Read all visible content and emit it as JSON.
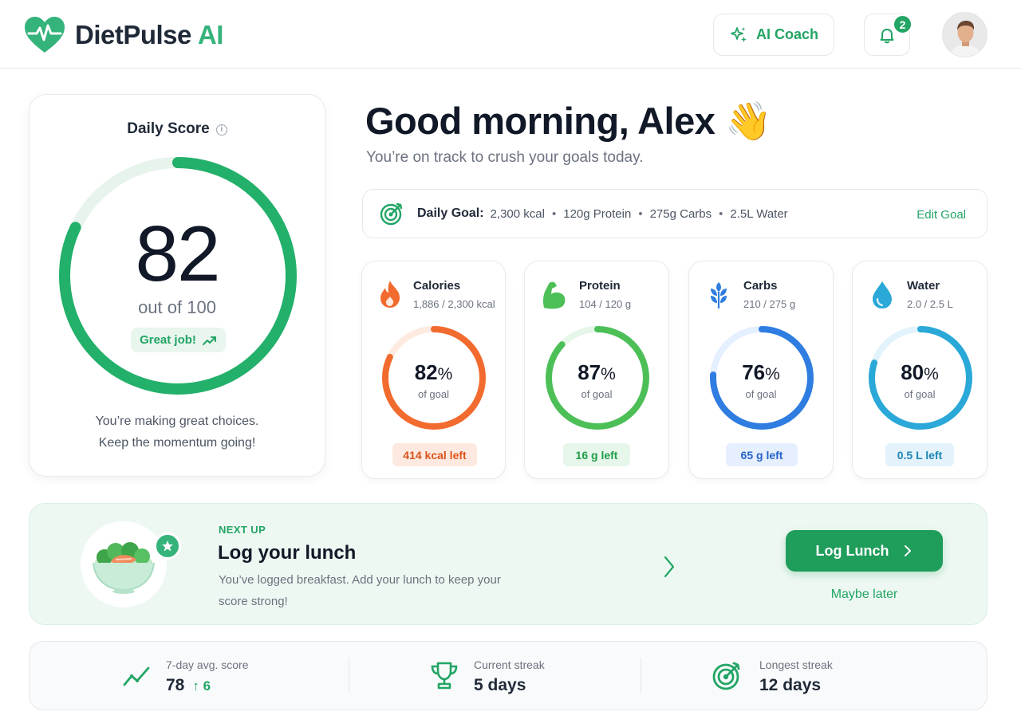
{
  "brand": {
    "name": "DietPulse",
    "suffix": "AI"
  },
  "header": {
    "coach_label": "AI Coach",
    "notifications_count": "2"
  },
  "score": {
    "title": "Daily Score",
    "value": "82",
    "out_of": "out of 100",
    "badge": "Great job!",
    "message_line1": "You’re making great choices.",
    "message_line2": "Keep the momentum going!",
    "progress_fraction": 0.82,
    "color": "#22b06a"
  },
  "greeting": {
    "title": "Good morning, Alex",
    "emoji": "👋",
    "subtitle": "You’re on track to crush your goals today."
  },
  "goal": {
    "label": "Daily Goal:",
    "items": [
      "2,300 kcal",
      "120g Protein",
      "275g Carbs",
      "2.5L Water"
    ],
    "separator": "•",
    "edit_label": "Edit Goal"
  },
  "macros": [
    {
      "name": "Calories",
      "value": "1,886 / 2,300 kcal",
      "percent": "82",
      "pct_sign": "%",
      "of_goal": "of goal",
      "left": "414 kcal left",
      "fraction": 0.82,
      "color": "#f26b2e",
      "track": "#fdebe1",
      "pill_bg": "#fde9e0",
      "pill_fg": "#d9541b",
      "icon": "fire-icon"
    },
    {
      "name": "Protein",
      "value": "104 / 120 g",
      "percent": "87",
      "pct_sign": "%",
      "of_goal": "of goal",
      "left": "16 g left",
      "fraction": 0.87,
      "color": "#4cbf56",
      "track": "#e6f6e8",
      "pill_bg": "#e7f6ea",
      "pill_fg": "#1f9d48",
      "icon": "flexed-arm-icon"
    },
    {
      "name": "Carbs",
      "value": "210 / 275 g",
      "percent": "76",
      "pct_sign": "%",
      "of_goal": "of goal",
      "left": "65 g left",
      "fraction": 0.76,
      "color": "#2f7de1",
      "track": "#e4efff",
      "pill_bg": "#e6effd",
      "pill_fg": "#2563c9",
      "icon": "grain-icon"
    },
    {
      "name": "Water",
      "value": "2.0 / 2.5 L",
      "percent": "80",
      "pct_sign": "%",
      "of_goal": "of goal",
      "left": "0.5 L left",
      "fraction": 0.8,
      "color": "#2aa8d8",
      "track": "#e3f3fb",
      "pill_bg": "#e4f3fb",
      "pill_fg": "#1e86b5",
      "icon": "water-drop-icon"
    }
  ],
  "next_up": {
    "kicker": "NEXT UP",
    "title": "Log your lunch",
    "description": "You’ve logged breakfast. Add your lunch to keep your score strong!",
    "button": "Log Lunch",
    "secondary": "Maybe later"
  },
  "stats": [
    {
      "label": "7-day avg. score",
      "value": "78",
      "delta": "↑ 6",
      "icon": "trend-line-icon"
    },
    {
      "label": "Current streak",
      "value": "5 days",
      "icon": "trophy-icon"
    },
    {
      "label": "Longest streak",
      "value": "12 days",
      "icon": "target-icon"
    }
  ],
  "colors": {
    "accent": "#22a565",
    "accent_dark": "#1f9d5b",
    "next_bg": "#eef8f2"
  }
}
